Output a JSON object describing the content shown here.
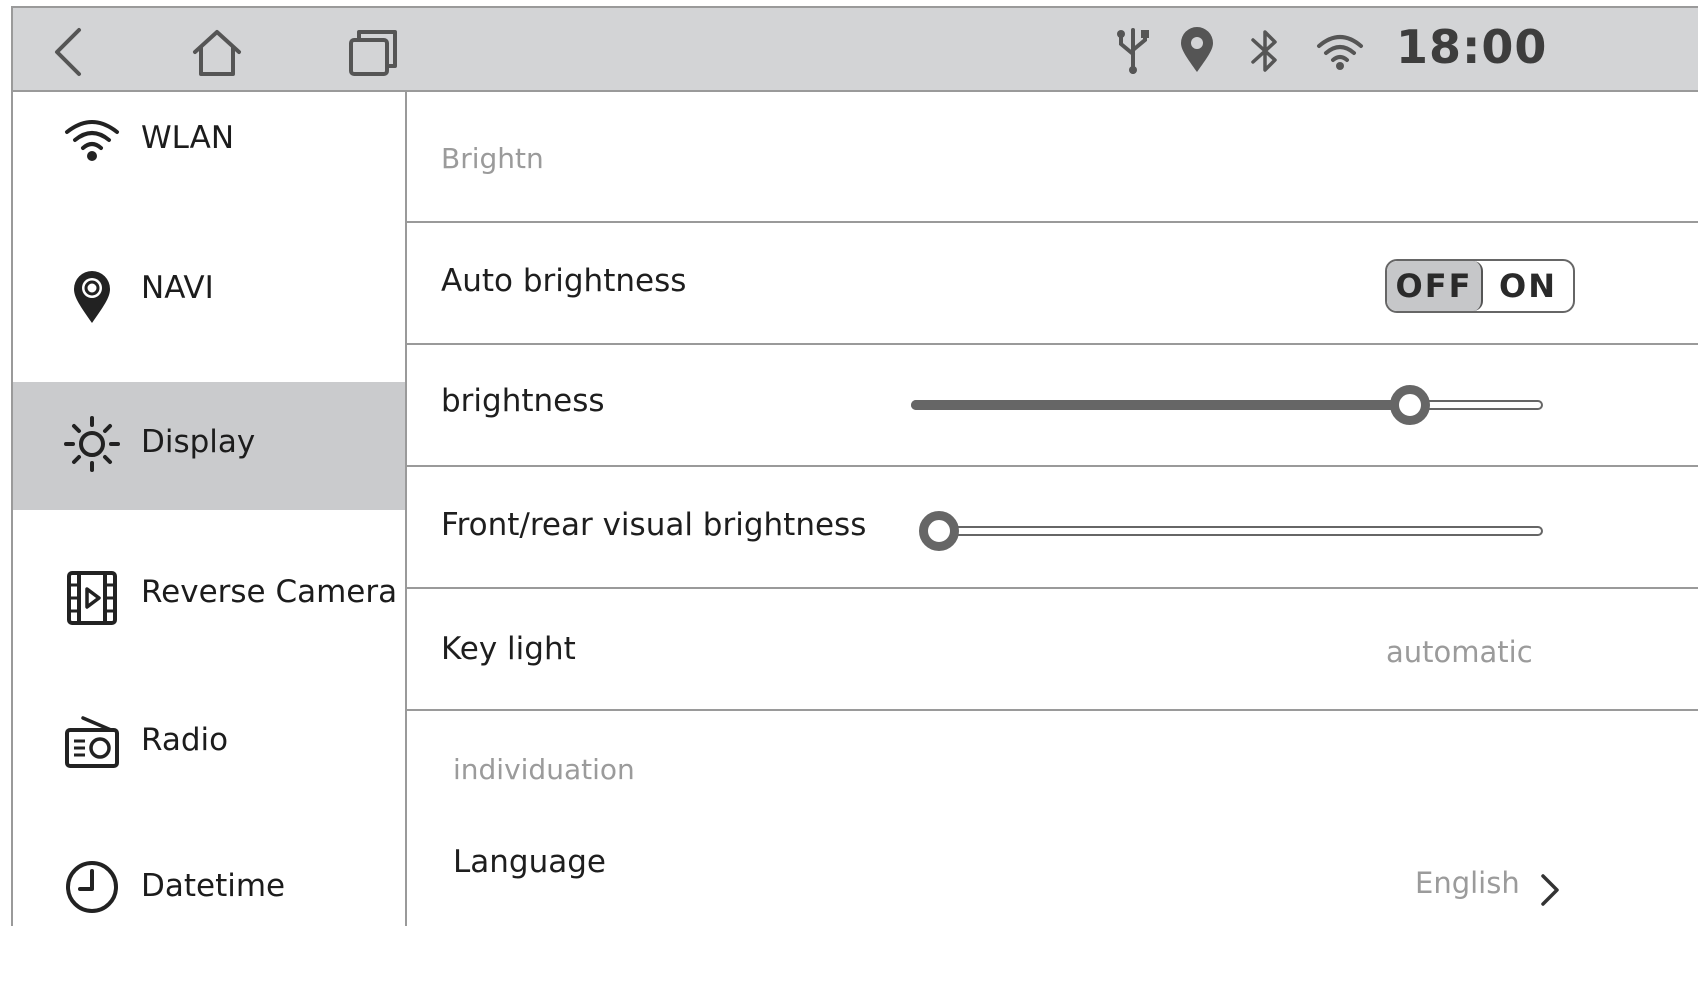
{
  "status_bar": {
    "time": "18:00",
    "icons": [
      "usb-icon",
      "location-icon",
      "bluetooth-icon",
      "wifi-icon"
    ]
  },
  "nav": {
    "buttons": [
      "back-icon",
      "home-icon",
      "recents-icon"
    ]
  },
  "sidebar": {
    "items": [
      {
        "label": "WLAN",
        "icon": "wifi-icon"
      },
      {
        "label": "NAVI",
        "icon": "map-pin-icon"
      },
      {
        "label": "Display",
        "icon": "sun-icon",
        "active": true
      },
      {
        "label": "Reverse Camera",
        "icon": "video-icon"
      },
      {
        "label": "Radio",
        "icon": "radio-icon"
      },
      {
        "label": "Datetime",
        "icon": "clock-icon"
      }
    ]
  },
  "content": {
    "section_brightness": "Brightn",
    "auto_brightness": {
      "label": "Auto brightness",
      "off_label": "OFF",
      "on_label": "ON",
      "state": "OFF"
    },
    "brightness": {
      "label": "brightness",
      "level": 0.79
    },
    "front_rear": {
      "label": "Front/rear visual brightness",
      "level": 0.0
    },
    "key_light": {
      "label": "Key light",
      "value": "automatic"
    },
    "section_individuation": "individuation",
    "language": {
      "label": "Language",
      "value": "English"
    }
  },
  "colors": {
    "statusbar_bg": "#d3d4d6",
    "active_item_bg": "#cacbcd",
    "divider": "#9a9a9a"
  }
}
